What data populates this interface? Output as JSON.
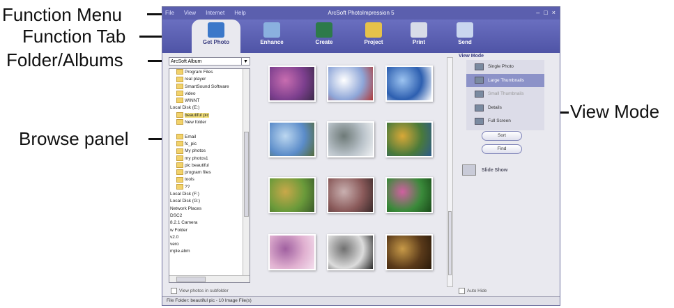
{
  "callouts": {
    "function_menu": "Function Menu",
    "function_tab": "Function Tab",
    "folder_albums": "Folder/Albums",
    "browse_panel": "Browse panel",
    "view_mode": "View Mode"
  },
  "window": {
    "title": "ArcSoft PhotoImpression 5",
    "menu": [
      "File",
      "View",
      "Internet",
      "Help"
    ],
    "controls": [
      "–",
      "□",
      "×"
    ]
  },
  "tabs": [
    {
      "label": "Get Photo",
      "icon": "get-photo-icon",
      "color": "#3b78c9"
    },
    {
      "label": "Enhance",
      "icon": "enhance-icon",
      "color": "#8ab0df"
    },
    {
      "label": "Create",
      "icon": "create-icon",
      "color": "#2d7a4a"
    },
    {
      "label": "Project",
      "icon": "project-icon",
      "color": "#e6c24a"
    },
    {
      "label": "Print",
      "icon": "print-icon",
      "color": "#d8dce8"
    },
    {
      "label": "Send",
      "icon": "send-icon",
      "color": "#c9d6ef"
    }
  ],
  "folder_panel": {
    "album_select": "ArcSoft Album",
    "tree": [
      {
        "label": "Program Files",
        "folder": true
      },
      {
        "label": "real player",
        "folder": true
      },
      {
        "label": "SmartSound Software",
        "folder": true
      },
      {
        "label": "video",
        "folder": true
      },
      {
        "label": "WINNT",
        "folder": true
      },
      {
        "label": "Local Disk (E:)",
        "folder": false
      },
      {
        "label": "beautiful pic",
        "folder": true,
        "selected": true
      },
      {
        "label": "New folder",
        "folder": true
      },
      {
        "label": "",
        "folder": false
      },
      {
        "label": "Email",
        "folder": true
      },
      {
        "label": "fc_pic",
        "folder": true
      },
      {
        "label": "My photos",
        "folder": true
      },
      {
        "label": "my photos1",
        "folder": true
      },
      {
        "label": "pic beautiful",
        "folder": true
      },
      {
        "label": "program files",
        "folder": true
      },
      {
        "label": "tools",
        "folder": true
      },
      {
        "label": "??",
        "folder": true
      },
      {
        "label": "Local Disk (F:)",
        "folder": false
      },
      {
        "label": "Local Disk (G:)",
        "folder": false
      },
      {
        "label": "Network Places",
        "folder": false
      },
      {
        "label": "DSC2",
        "folder": false
      },
      {
        "label": "8.2.1 Camera",
        "folder": false
      },
      {
        "label": "w Folder",
        "folder": false
      },
      {
        "label": "v2.0",
        "folder": false
      },
      {
        "label": "vero",
        "folder": false
      },
      {
        "label": "mple.abm",
        "folder": false
      }
    ],
    "checkbox_label": "View photos in subfolder"
  },
  "browse": {
    "thumbnails": [
      {
        "colors": [
          "#7c3f8e",
          "#c86db0",
          "#3c2a4a"
        ]
      },
      {
        "colors": [
          "#8ea6d8",
          "#ffffff",
          "#b03a3a"
        ]
      },
      {
        "colors": [
          "#2d5fb0",
          "#9cc3f0",
          "#ffffff"
        ]
      },
      {
        "colors": [
          "#5b8cc9",
          "#bcd7f0",
          "#556b3a"
        ]
      },
      {
        "colors": [
          "#b9c2c9",
          "#6e7a78",
          "#f0f2f4"
        ]
      },
      {
        "colors": [
          "#4a7a3a",
          "#d8a838",
          "#2d5a8a"
        ]
      },
      {
        "colors": [
          "#6a9a3a",
          "#c9a84a",
          "#3a5a2a"
        ]
      },
      {
        "colors": [
          "#8a5a5a",
          "#c9b0b0",
          "#3a2a2a"
        ]
      },
      {
        "colors": [
          "#3a8a3a",
          "#d060a0",
          "#1a4a1a"
        ]
      },
      {
        "colors": [
          "#e0b0d0",
          "#a060a0",
          "#f4e0ee"
        ]
      },
      {
        "colors": [
          "#dcdcdc",
          "#707070",
          "#2a2a2a"
        ]
      },
      {
        "colors": [
          "#5a3a1a",
          "#c89a48",
          "#2a1a0a"
        ]
      }
    ]
  },
  "view_mode": {
    "title": "View Mode",
    "items": [
      {
        "label": "Single Photo",
        "icon": "single-photo-icon",
        "state": "normal"
      },
      {
        "label": "Large Thumbnails",
        "icon": "large-thumbnails-icon",
        "state": "active"
      },
      {
        "label": "Small Thumbnails",
        "icon": "small-thumbnails-icon",
        "state": "dim"
      },
      {
        "label": "Details",
        "icon": "details-icon",
        "state": "normal"
      },
      {
        "label": "Full Screen",
        "icon": "full-screen-icon",
        "state": "normal"
      }
    ],
    "sort_label": "Sort",
    "find_label": "Find",
    "slideshow_label": "Slide Show",
    "auto_hide_label": "Auto Hide"
  },
  "status": {
    "text": "File Folder: beautiful pic - 10 Image File(s)"
  }
}
